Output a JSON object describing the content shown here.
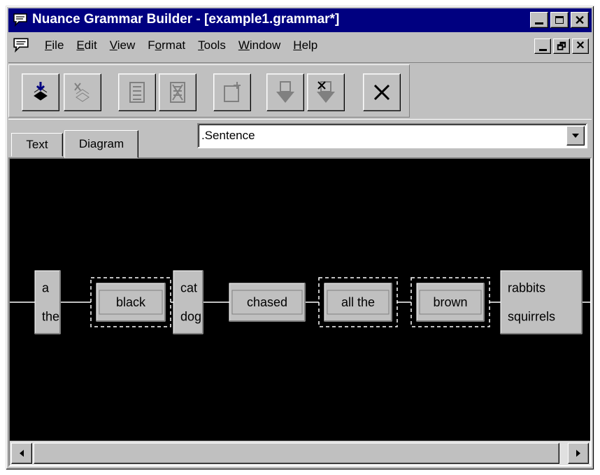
{
  "window": {
    "title": "Nuance Grammar Builder - [example1.grammar*]"
  },
  "menu": {
    "items": [
      {
        "label": "File",
        "accel": "F"
      },
      {
        "label": "Edit",
        "accel": "E"
      },
      {
        "label": "View",
        "accel": "V"
      },
      {
        "label": "Format",
        "accel": "o"
      },
      {
        "label": "Tools",
        "accel": "T"
      },
      {
        "label": "Window",
        "accel": "W"
      },
      {
        "label": "Help",
        "accel": "H"
      }
    ]
  },
  "toolbar": {
    "buttons": [
      {
        "name": "import-icon",
        "enabled": true
      },
      {
        "name": "export-icon",
        "enabled": false
      },
      {
        "name": "add-rule-icon",
        "enabled": false
      },
      {
        "name": "delete-rule-icon",
        "enabled": false
      },
      {
        "name": "new-item-icon",
        "enabled": false
      },
      {
        "name": "insert-down-icon",
        "enabled": false
      },
      {
        "name": "remove-down-icon",
        "enabled": false
      },
      {
        "name": "close-icon",
        "enabled": true
      }
    ]
  },
  "tabs": [
    {
      "label": "Text",
      "active": false
    },
    {
      "label": "Diagram",
      "active": true
    }
  ],
  "rule_selector": {
    "value": ".Sentence"
  },
  "diagram": {
    "nodes": [
      {
        "words": [
          "a",
          "the"
        ],
        "optional": false
      },
      {
        "words": [
          "black"
        ],
        "optional": true
      },
      {
        "words": [
          "cat",
          "dog"
        ],
        "optional": false
      },
      {
        "words": [
          "chased"
        ],
        "optional": false
      },
      {
        "words": [
          "all the"
        ],
        "optional": true
      },
      {
        "words": [
          "brown"
        ],
        "optional": true
      },
      {
        "words": [
          "rabbits",
          "squirrels"
        ],
        "optional": false
      }
    ]
  }
}
